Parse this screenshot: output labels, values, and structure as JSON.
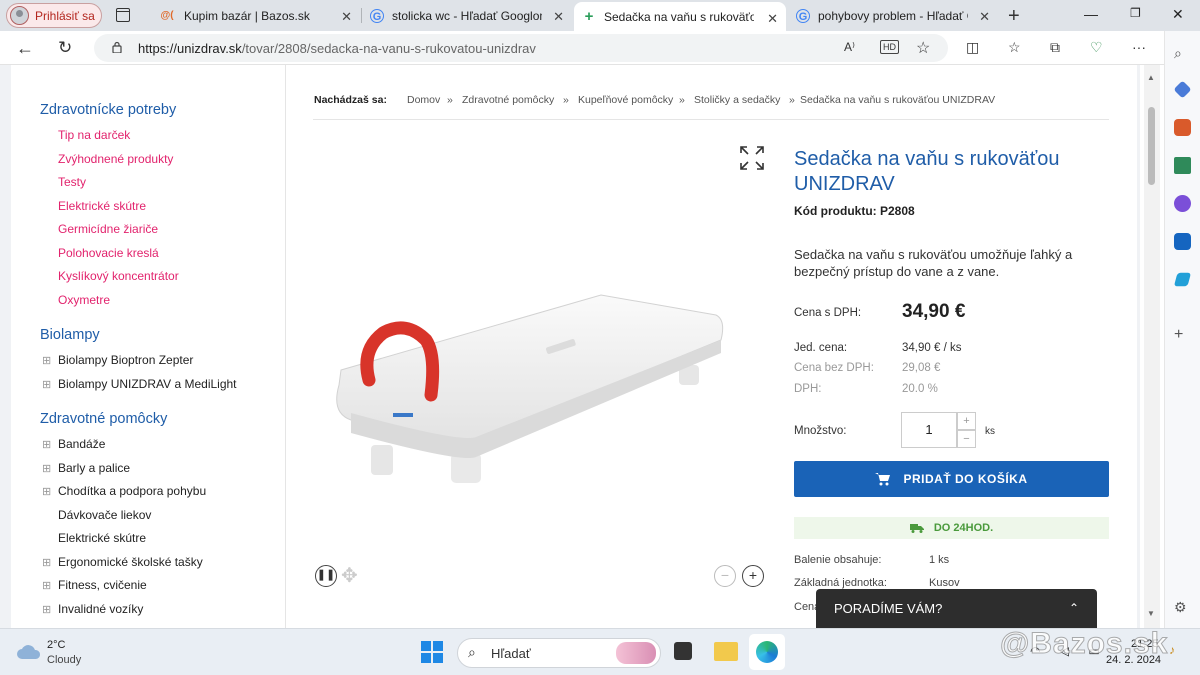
{
  "browser": {
    "profile_label": "Prihlásiť sa",
    "tabs": [
      {
        "title": "Kupim bazár | Bazos.sk",
        "favicon": "@("
      },
      {
        "title": "stolicka wc - Hľadať Googlom",
        "favicon": "G"
      },
      {
        "title": "Sedačka na vaňu s rukoväťou U",
        "favicon": "+"
      },
      {
        "title": "pohybovy problem - Hľadať Go",
        "favicon": "G"
      }
    ],
    "url_host": "https://unizdrav.sk",
    "url_path": "/tovar/2808/sedacka-na-vanu-s-rukovatou-unizdrav"
  },
  "sidebar": {
    "cat1": "Zdravotnícke potreby",
    "cat1_items": [
      "Tip na darček",
      "Zvýhodnené produkty",
      "Testy",
      "Elektrické skútre",
      "Germicídne žiariče",
      "Polohovacie kreslá",
      "Kyslíkový koncentrátor",
      "Oxymetre"
    ],
    "cat2": "Biolampy",
    "cat2_items": [
      "Biolampy Bioptron Zepter",
      "Biolampy UNIZDRAV a MediLight"
    ],
    "cat3": "Zdravotné pomôcky",
    "cat3_items": [
      "Bandáže",
      "Barly a palice",
      "Chodítka a podpora pohybu",
      "Dávkovače liekov",
      "Elektrické skútre",
      "Ergonomické školské tašky",
      "Fitness, cvičenie",
      "Invalidné vozíky"
    ]
  },
  "breadcrumb": {
    "label": "Nachádzaš sa:",
    "items": [
      "Domov",
      "Zdravotné pomôcky",
      "Kupeľňové pomôcky",
      "Stoličky a sedačky",
      "Sedačka na vaňu s rukoväťou UNIZDRAV"
    ],
    "sep": "»"
  },
  "product": {
    "title": "Sedačka na vaňu s rukoväťou UNIZDRAV",
    "code": "Kód produktu: P2808",
    "description": "Sedačka na vaňu s rukoväťou umožňuje ľahký a bezpečný prístup do vane a z vane.",
    "price_label": "Cena s DPH:",
    "price": "34,90 €",
    "unit_label": "Jed. cena:",
    "unit_price": "34,90 € / ks",
    "net_label": "Cena bez DPH:",
    "net_price": "29,08 €",
    "vat_label": "DPH:",
    "vat": "20.0 %",
    "qty_label": "Množstvo:",
    "qty": "1",
    "qty_unit": "ks",
    "cart_button": "PRIDAŤ DO KOŠÍKA",
    "delivery": "DO 24HOD.",
    "pack_label": "Balenie obsahuje:",
    "pack_value": "1 ks",
    "base_label": "Základná jednotka:",
    "base_value": "Kusov",
    "cut_label": "Cena"
  },
  "chat": {
    "label": "PORADÍME VÁM?"
  },
  "taskbar": {
    "temp": "2°C",
    "weather": "Cloudy",
    "search": "Hľadať",
    "time": "21:25",
    "date": "24. 2. 2024",
    "watermark": "@Bazos.sk"
  }
}
